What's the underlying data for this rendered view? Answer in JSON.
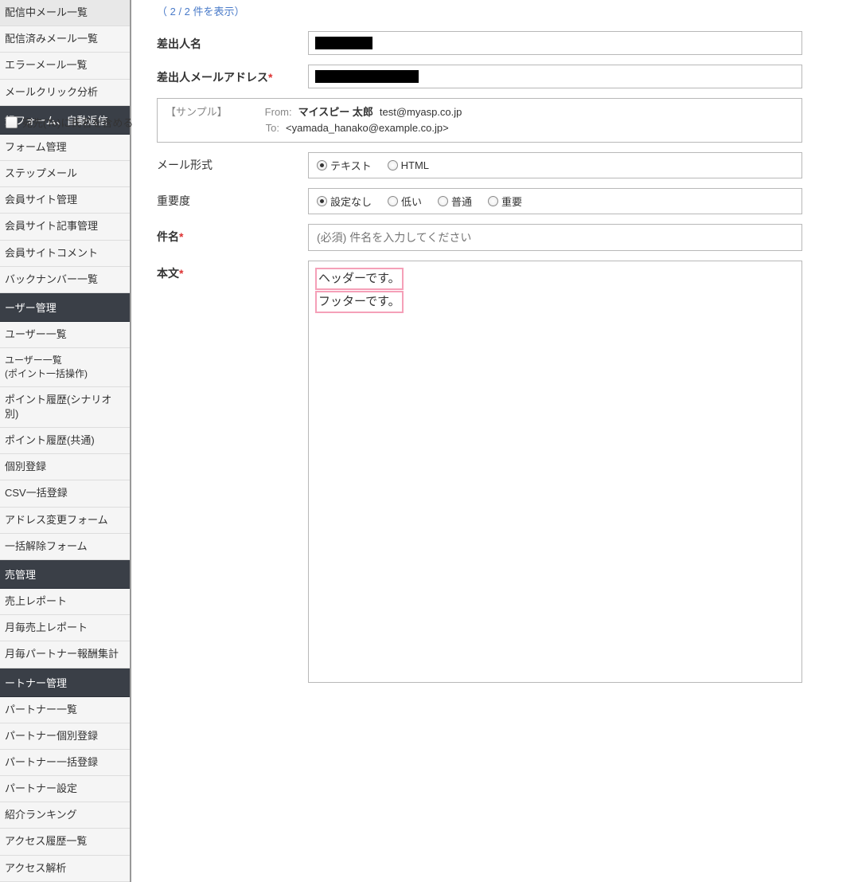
{
  "sidebar": {
    "items_top": [
      "配信中メール一覧",
      "配信済みメール一覧",
      "エラーメール一覧",
      "メールクリック分析"
    ],
    "section_form": "録フォーム、自動返信",
    "items_form": [
      "フォーム管理",
      "ステップメール",
      "会員サイト管理",
      "会員サイト記事管理",
      "会員サイトコメント",
      "バックナンバー一覧"
    ],
    "section_user": "ーザー管理",
    "items_user": [
      "ユーザー一覧"
    ],
    "item_user_multi": "ユーザー一覧\n(ポイント一括操作)",
    "items_user2": [
      "ポイント履歴(シナリオ別)",
      "ポイント履歴(共通)",
      "個別登録",
      "CSV一括登録",
      "アドレス変更フォーム",
      "一括解除フォーム"
    ],
    "section_sales": "売管理",
    "items_sales": [
      "売上レポート",
      "月毎売上レポート",
      "月毎パートナー報酬集計"
    ],
    "section_partner": "ートナー管理",
    "items_partner": [
      "パートナー一覧",
      "パートナー個別登録",
      "パートナー一括登録",
      "パートナー設定",
      "紹介ランキング",
      "アクセス履歴一覧",
      "アクセス解析"
    ]
  },
  "form": {
    "count_text": "（ 2 / 2 件を表示）",
    "sender_name_label": "差出人名",
    "sender_email_label": "差出人メールアドレス",
    "to_checkbox_label": "宛先(To)に氏名を含める",
    "sample": {
      "label": "【サンプル】",
      "from_label": "From:",
      "from_name": "マイスピー 太郎",
      "from_email": "test@myasp.co.jp",
      "to_label": "To:",
      "to_value": "<yamada_hanako@example.co.jp>"
    },
    "mail_format_label": "メール形式",
    "mail_format_options": {
      "text": "テキスト",
      "html": "HTML"
    },
    "priority_label": "重要度",
    "priority_options": {
      "none": "設定なし",
      "low": "低い",
      "normal": "普通",
      "high": "重要"
    },
    "subject_label": "件名",
    "subject_placeholder": "(必須) 件名を入力してください",
    "body_label": "本文",
    "body_header": "ヘッダーです。",
    "body_footer": "フッターです。"
  }
}
